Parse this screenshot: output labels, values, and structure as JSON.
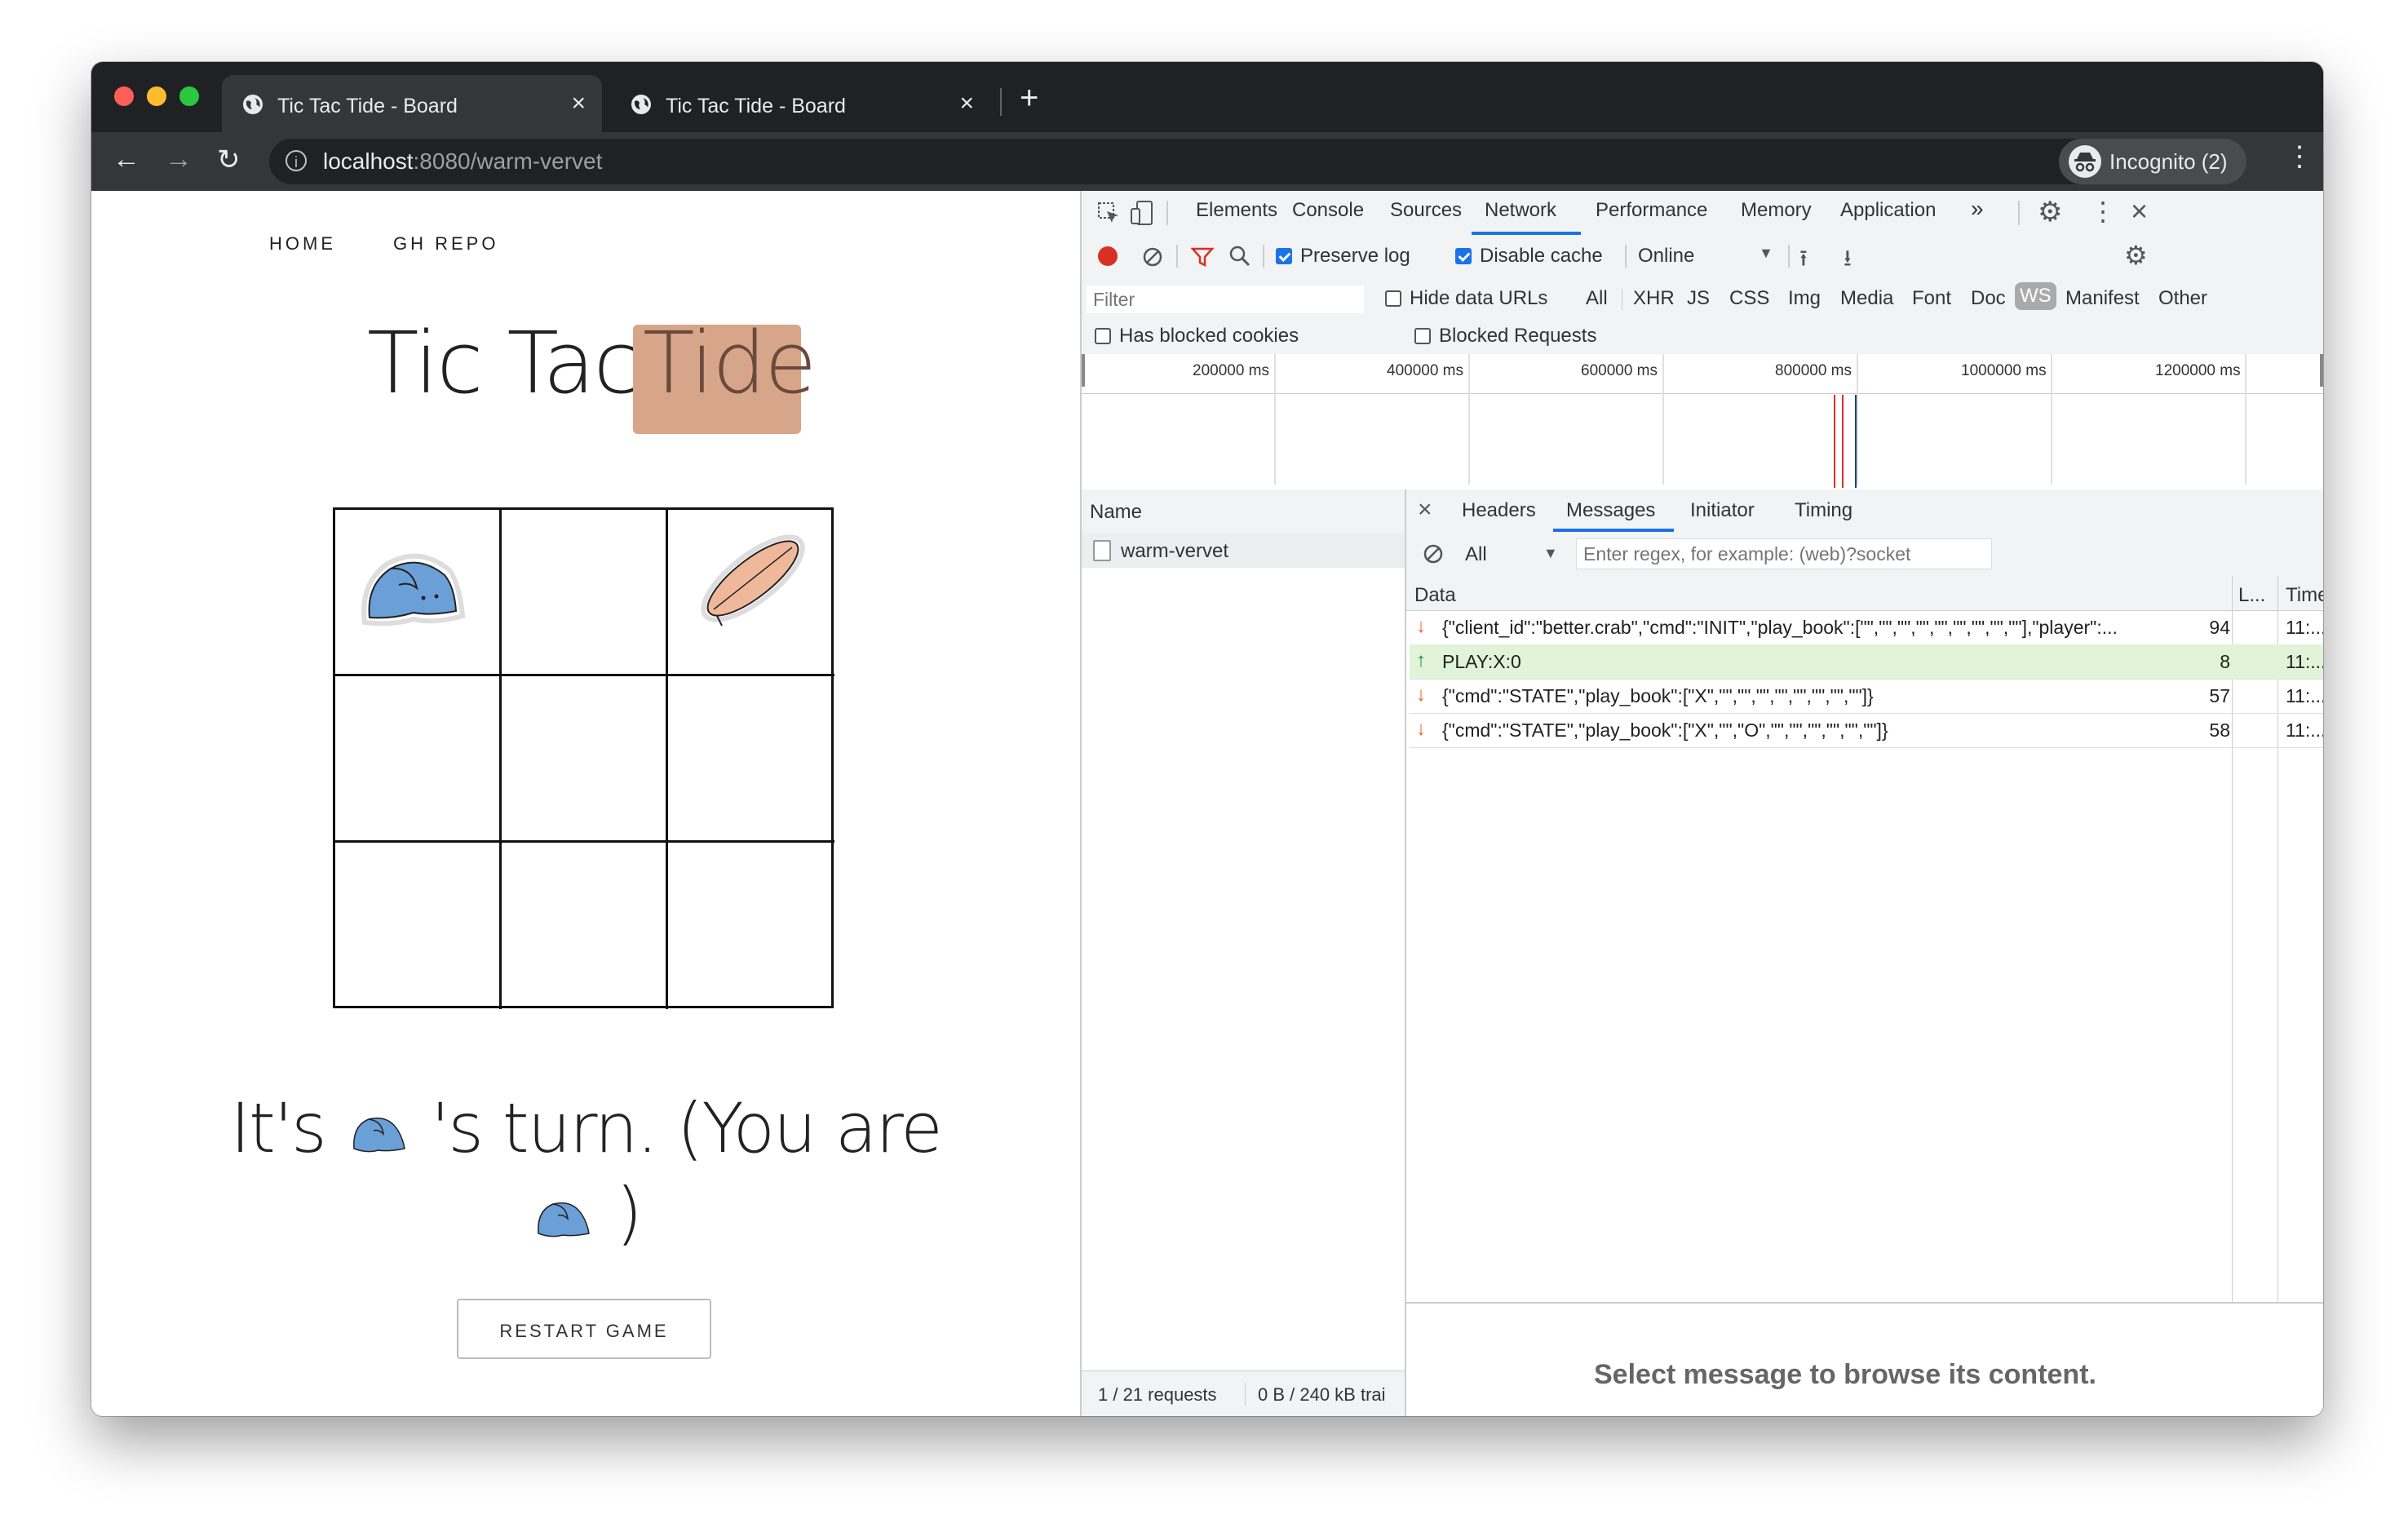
{
  "browser": {
    "tabs": [
      {
        "title": "Tic Tac Tide - Board",
        "active": true
      },
      {
        "title": "Tic Tac Tide - Board",
        "active": false
      }
    ],
    "new_tab": "+",
    "url_host": "localhost",
    "url_rest": ":8080/warm-vervet",
    "incognito_label": "Incognito (2)"
  },
  "page": {
    "nav": [
      "HOME",
      "GH REPO"
    ],
    "title_main": "Tic Tac ",
    "title_highlight": "Tide",
    "board": [
      "X",
      "",
      "O",
      "",
      "",
      "",
      "",
      "",
      ""
    ],
    "turn_prefix": "It's",
    "turn_middle": "'s turn. (You are",
    "turn_suffix": ")",
    "restart_label": "RESTART GAME"
  },
  "devtools": {
    "tabs": [
      "Elements",
      "Console",
      "Sources",
      "Network",
      "Performance",
      "Memory",
      "Application"
    ],
    "active_tab": "Network",
    "more": "»",
    "preserve_log": "Preserve log",
    "disable_cache": "Disable cache",
    "throttle": "Online",
    "filter_placeholder": "Filter",
    "hide_data_urls": "Hide data URLs",
    "filter_types": [
      "All",
      "XHR",
      "JS",
      "CSS",
      "Img",
      "Media",
      "Font",
      "Doc",
      "WS",
      "Manifest",
      "Other"
    ],
    "active_filter": "WS",
    "has_blocked_cookies": "Has blocked cookies",
    "blocked_requests": "Blocked Requests",
    "timeline_labels": [
      "200000 ms",
      "400000 ms",
      "600000 ms",
      "800000 ms",
      "1000000 ms",
      "1200000 ms"
    ],
    "name_header": "Name",
    "request_name": "warm-vervet",
    "detail_tabs": [
      "Headers",
      "Messages",
      "Initiator",
      "Timing"
    ],
    "active_detail_tab": "Messages",
    "msg_filter_select": "All",
    "msg_filter_placeholder": "Enter regex, for example: (web)?socket",
    "col_data": "Data",
    "col_length": "L...",
    "col_time": "Time",
    "messages": [
      {
        "dir": "received",
        "data": "{\"client_id\":\"better.crab\",\"cmd\":\"INIT\",\"play_book\":[\"\",\"\",\"\",\"\",\"\",\"\",\"\",\"\",\"\"],\"player\":...",
        "length": "94",
        "time": "11:..."
      },
      {
        "dir": "sent",
        "data": "PLAY:X:0",
        "length": "8",
        "time": "11:..."
      },
      {
        "dir": "received",
        "data": "{\"cmd\":\"STATE\",\"play_book\":[\"X\",\"\",\"\",\"\",\"\",\"\",\"\",\"\",\"\"]}",
        "length": "57",
        "time": "11:..."
      },
      {
        "dir": "received",
        "data": "{\"cmd\":\"STATE\",\"play_book\":[\"X\",\"\",\"O\",\"\",\"\",\"\",\"\",\"\",\"\"]}",
        "length": "58",
        "time": "11:..."
      }
    ],
    "status_requests": "1 / 21 requests",
    "status_transfer": "0 B / 240 kB trai",
    "empty_message": "Select message to browse its content.",
    "colors": {
      "sent_row": "#e1f3d8",
      "received_arrow": "#e8622b",
      "sent_arrow": "#1e8e3e",
      "accent": "#1a73e8"
    }
  }
}
